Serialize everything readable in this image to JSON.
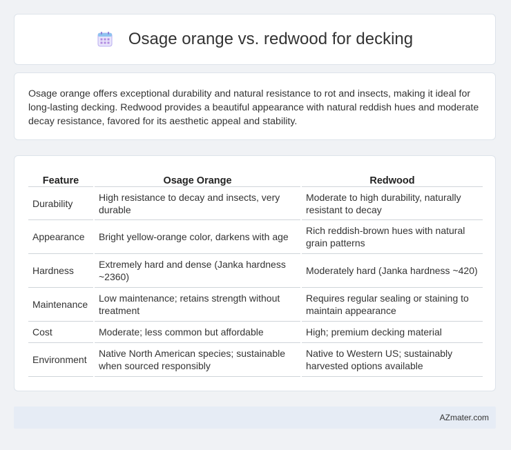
{
  "header": {
    "title": "Osage orange vs. redwood for decking",
    "icon": "calendar-icon"
  },
  "summary": {
    "text": "Osage orange offers exceptional durability and natural resistance to rot and insects, making it ideal for long-lasting decking. Redwood provides a beautiful appearance with natural reddish hues and moderate decay resistance, favored for its aesthetic appeal and stability."
  },
  "table": {
    "headers": [
      "Feature",
      "Osage Orange",
      "Redwood"
    ],
    "rows": [
      [
        "Durability",
        "High resistance to decay and insects, very durable",
        "Moderate to high durability, naturally resistant to decay"
      ],
      [
        "Appearance",
        "Bright yellow-orange color, darkens with age",
        "Rich reddish-brown hues with natural grain patterns"
      ],
      [
        "Hardness",
        "Extremely hard and dense (Janka hardness ~2360)",
        "Moderately hard (Janka hardness ~420)"
      ],
      [
        "Maintenance",
        "Low maintenance; retains strength without treatment",
        "Requires regular sealing or staining to maintain appearance"
      ],
      [
        "Cost",
        "Moderate; less common but affordable",
        "High; premium decking material"
      ],
      [
        "Environment",
        "Native North American species; sustainable when sourced responsibly",
        "Native to Western US; sustainably harvested options available"
      ]
    ]
  },
  "footer": {
    "text": "AZmater.com"
  },
  "colors": {
    "background": "#f0f2f5",
    "card": "#ffffff",
    "footer": "#e6ecf5",
    "icon_accent": "#8a7fd6"
  }
}
